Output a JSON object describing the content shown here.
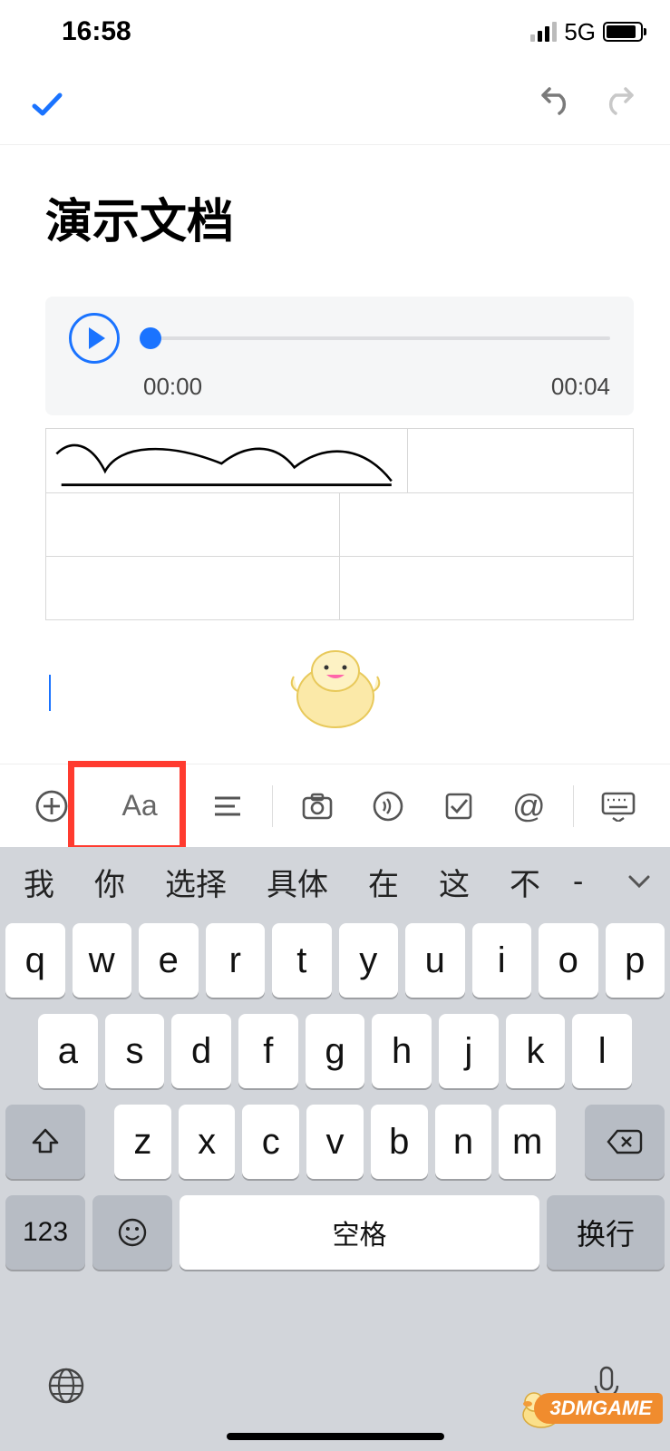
{
  "status": {
    "time": "16:58",
    "network": "5G"
  },
  "doc": {
    "title": "演示文档"
  },
  "audio": {
    "current": "00:00",
    "total": "00:04"
  },
  "formatbar": {
    "add": "add",
    "font": "Aa",
    "para": "paragraph",
    "camera": "camera",
    "voice": "voice",
    "check": "checklist",
    "mention": "@",
    "kb": "keyboard"
  },
  "candidates": [
    "我",
    "你",
    "选择",
    "具体",
    "在",
    "这",
    "不",
    "-"
  ],
  "rows": {
    "r1": [
      "q",
      "w",
      "e",
      "r",
      "t",
      "y",
      "u",
      "i",
      "o",
      "p"
    ],
    "r2": [
      "a",
      "s",
      "d",
      "f",
      "g",
      "h",
      "j",
      "k",
      "l"
    ],
    "r3": [
      "z",
      "x",
      "c",
      "v",
      "b",
      "n",
      "m"
    ]
  },
  "keys": {
    "num": "123",
    "space": "空格",
    "enter": "换行"
  },
  "watermark": "3DMGAME"
}
